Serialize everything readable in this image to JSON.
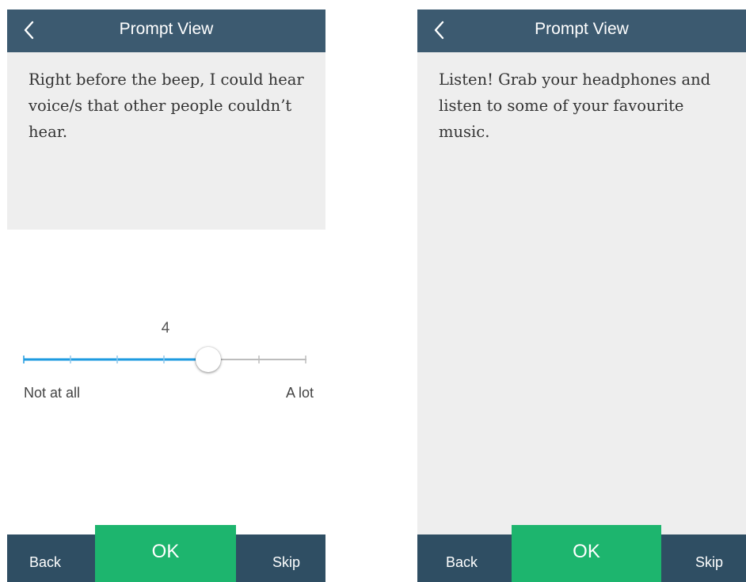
{
  "screens": [
    {
      "header": {
        "title": "Prompt View"
      },
      "prompt": {
        "text": "Right before the beep, I could hear voice/s that other people couldn’t hear."
      },
      "slider": {
        "value": "4",
        "min_label": "Not at all",
        "max_label": "A lot",
        "position_fraction": 0.65
      },
      "bottom": {
        "back_label": "Back",
        "ok_label": "OK",
        "skip_label": "Skip"
      }
    },
    {
      "header": {
        "title": "Prompt View"
      },
      "prompt": {
        "text": "Listen! Grab your headphones and listen to some of your favourite music."
      },
      "bottom": {
        "back_label": "Back",
        "ok_label": "OK",
        "skip_label": "Skip"
      }
    }
  ],
  "colors": {
    "header": "#3c5a70",
    "bottom_bar": "#2f4e63",
    "ok_button": "#1db56e",
    "slider_active": "#1e9be0",
    "slider_inactive": "#bdbdbd",
    "prompt_background": "#eeeeee"
  },
  "icons": {
    "header_back": "chevron-left-icon"
  }
}
